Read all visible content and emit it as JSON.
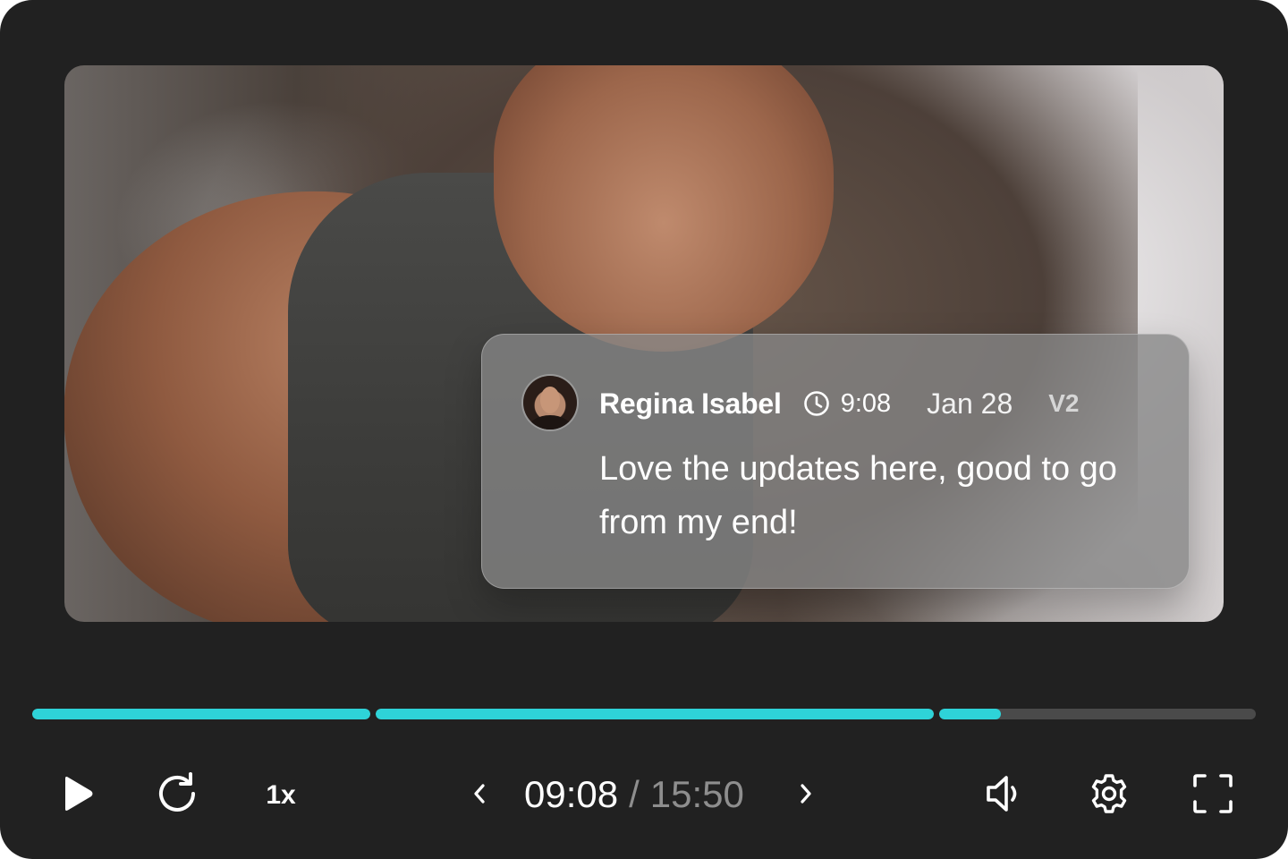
{
  "comment": {
    "author": "Regina Isabel",
    "timestamp": "9:08",
    "date": "Jan 28",
    "version": "V2",
    "text": "Love the updates here, good to go from my end!"
  },
  "progress": {
    "segments": [
      {
        "fill": 1.0
      },
      {
        "fill": 1.0
      },
      {
        "fill": 0.195
      }
    ],
    "accent_color": "#2ed3d8",
    "track_color": "#4a4a4a"
  },
  "controls": {
    "play_icon": "play-icon",
    "replay_icon": "replay-icon",
    "speed": "1x",
    "prev_icon": "chevron-left-icon",
    "current_time": "09:08",
    "separator": "/",
    "duration": "15:50",
    "next_icon": "chevron-right-icon",
    "volume_icon": "volume-icon",
    "settings_icon": "gear-icon",
    "fullscreen_icon": "fullscreen-icon"
  },
  "colors": {
    "player_bg": "#212121",
    "time_secondary": "#8e8e8e"
  }
}
